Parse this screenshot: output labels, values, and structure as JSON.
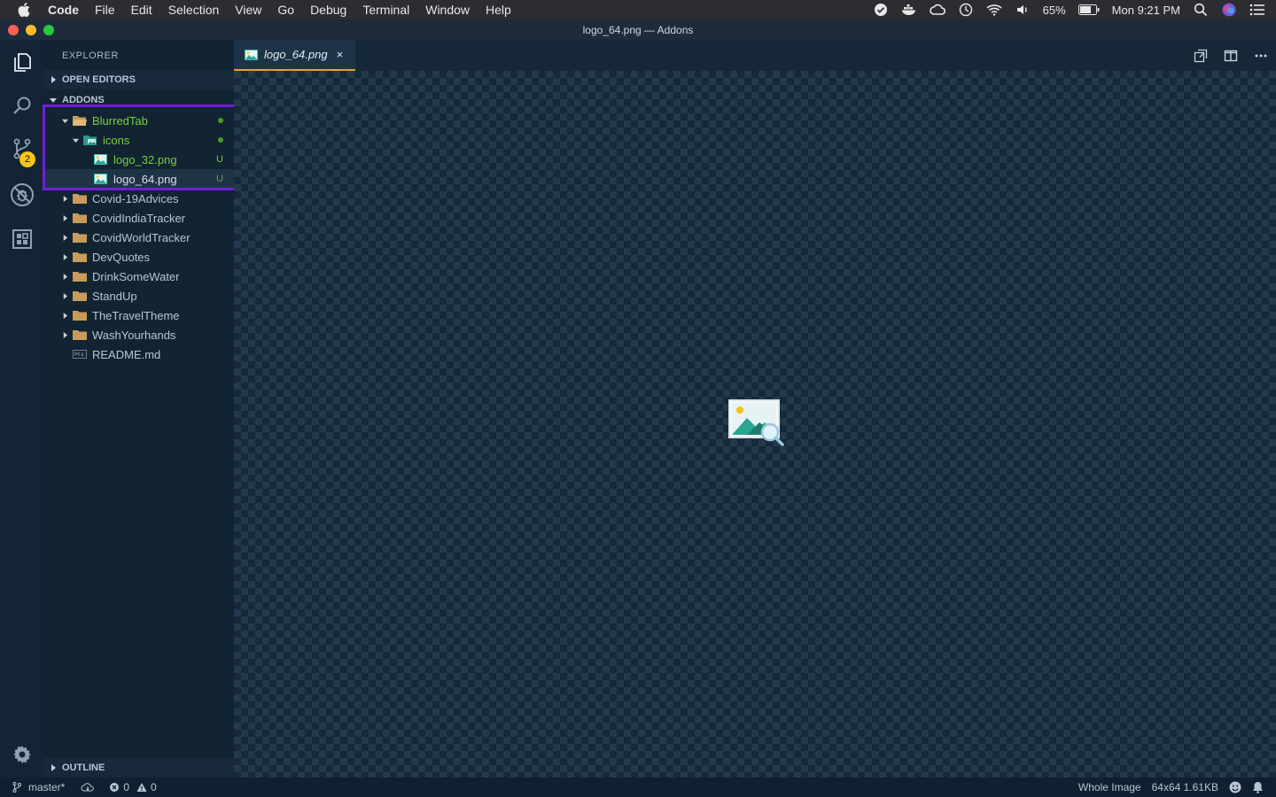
{
  "menubar": {
    "app_name": "Code",
    "items": [
      "File",
      "Edit",
      "Selection",
      "View",
      "Go",
      "Debug",
      "Terminal",
      "Window",
      "Help"
    ],
    "battery": "65%",
    "clock": "Mon 9:21 PM"
  },
  "window": {
    "title": "logo_64.png — Addons"
  },
  "activity": {
    "icons": [
      "explorer-icon",
      "search-icon",
      "source-control-icon",
      "no-bugs-icon",
      "extensions-icon",
      "gear-icon"
    ],
    "scm_badge": "2"
  },
  "sidebar": {
    "title": "EXPLORER",
    "open_editors": "OPEN EDITORS",
    "workspace": "ADDONS",
    "outline": "OUTLINE",
    "tree": [
      {
        "label": "BlurredTab",
        "status": "●",
        "type": "folder-open"
      },
      {
        "label": "icons",
        "status": "●",
        "type": "folder-images-open"
      },
      {
        "label": "logo_32.png",
        "status": "U",
        "type": "image"
      },
      {
        "label": "logo_64.png",
        "status": "U",
        "type": "image"
      },
      {
        "label": "Covid-19Advices",
        "type": "folder"
      },
      {
        "label": "CovidIndiaTracker",
        "type": "folder"
      },
      {
        "label": "CovidWorldTracker",
        "type": "folder"
      },
      {
        "label": "DevQuotes",
        "type": "folder"
      },
      {
        "label": "DrinkSomeWater",
        "type": "folder"
      },
      {
        "label": "StandUp",
        "type": "folder"
      },
      {
        "label": "TheTravelTheme",
        "type": "folder"
      },
      {
        "label": "WashYourhands",
        "type": "folder"
      },
      {
        "label": "README.md",
        "type": "markdown"
      }
    ]
  },
  "editor": {
    "tab_label": "logo_64.png",
    "tab_close": "×"
  },
  "statusbar": {
    "branch": "master*",
    "errors": "0",
    "warnings": "0",
    "zoom": "Whole Image",
    "image_info": "64x64 1.61KB"
  },
  "colors": {
    "accent_tab": "#e6a232",
    "untracked_green": "#74d23c",
    "highlight_box": "#6e1fd6",
    "badge": "#f5c518"
  }
}
